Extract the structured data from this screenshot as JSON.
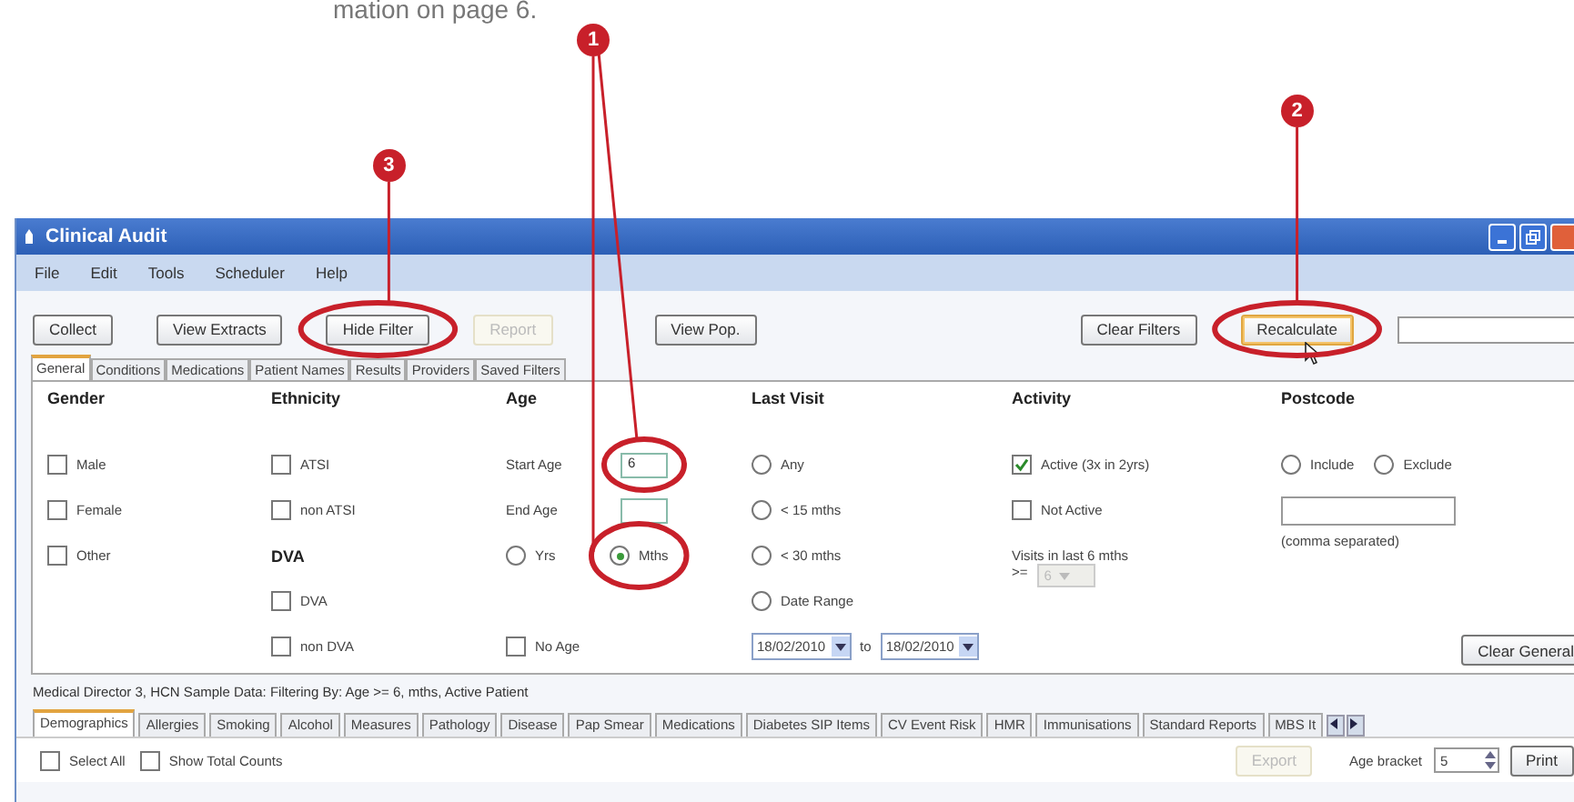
{
  "page_caption": "mation on page 6.",
  "callouts": [
    {
      "number": "1"
    },
    {
      "number": "2"
    },
    {
      "number": "3"
    }
  ],
  "window": {
    "title": "Clinical Audit",
    "menu": [
      "File",
      "Edit",
      "Tools",
      "Scheduler",
      "Help"
    ],
    "toolbar_left": [
      {
        "label": "Collect",
        "disabled": false
      },
      {
        "label": "View Extracts",
        "disabled": false
      },
      {
        "label": "Hide Filter",
        "disabled": false
      },
      {
        "label": "Report",
        "disabled": true
      },
      {
        "label": "View Pop.",
        "disabled": false
      }
    ],
    "toolbar_right": [
      {
        "label": "Clear Filters",
        "hovered": false
      },
      {
        "label": "Recalculate",
        "hovered": true
      }
    ],
    "filter_tabs": [
      {
        "label": "General",
        "selected": true
      },
      {
        "label": "Conditions",
        "selected": false
      },
      {
        "label": "Medications",
        "selected": false
      },
      {
        "label": "Patient Names",
        "selected": false
      },
      {
        "label": "Results",
        "selected": false
      },
      {
        "label": "Providers",
        "selected": false
      },
      {
        "label": "Saved Filters",
        "selected": false
      }
    ],
    "general": {
      "gender": {
        "heading": "Gender",
        "options": [
          {
            "label": "Male",
            "checked": false
          },
          {
            "label": "Female",
            "checked": false
          },
          {
            "label": "Other",
            "checked": false
          }
        ]
      },
      "ethnicity": {
        "heading": "Ethnicity",
        "options": [
          {
            "label": "ATSI",
            "checked": false
          },
          {
            "label": "non ATSI",
            "checked": false
          }
        ],
        "dva_heading": "DVA",
        "dva_options": [
          {
            "label": "DVA",
            "checked": false
          },
          {
            "label": "non DVA",
            "checked": false
          }
        ]
      },
      "age": {
        "heading": "Age",
        "start_label": "Start Age",
        "start_value": "6",
        "end_label": "End Age",
        "units": [
          {
            "label": "Yrs",
            "selected": false
          },
          {
            "label": "Mths",
            "selected": true
          }
        ],
        "no_age": {
          "label": "No Age",
          "checked": false
        }
      },
      "last_visit": {
        "heading": "Last Visit",
        "options": [
          {
            "label": "Any",
            "selected": false
          },
          {
            "label": "< 15 mths",
            "selected": false
          },
          {
            "label": "< 30 mths",
            "selected": false
          },
          {
            "label": "Date Range",
            "selected": false
          }
        ],
        "date_from": "18/02/2010",
        "to_label": "to",
        "date_to": "18/02/2010"
      },
      "activity": {
        "heading": "Activity",
        "options": [
          {
            "label": "Active (3x in 2yrs)",
            "checked": true
          },
          {
            "label": "Not Active",
            "checked": false
          }
        ],
        "visits_label": "Visits in last 6 mths",
        "ge_label": ">=",
        "visits_value": "6"
      },
      "postcode": {
        "heading": "Postcode",
        "options": [
          {
            "label": "Include",
            "selected": false
          },
          {
            "label": "Exclude",
            "selected": false
          }
        ],
        "hint": "(comma separated)"
      },
      "clear_button": "Clear General"
    },
    "status": "Medical Director 3, HCN Sample Data: Filtering By: Age >= 6, mths, Active Patient",
    "report_tabs": [
      {
        "label": "Demographics",
        "selected": true
      },
      {
        "label": "Allergies",
        "selected": false
      },
      {
        "label": "Smoking",
        "selected": false
      },
      {
        "label": "Alcohol",
        "selected": false
      },
      {
        "label": "Measures",
        "selected": false
      },
      {
        "label": "Pathology",
        "selected": false
      },
      {
        "label": "Disease",
        "selected": false
      },
      {
        "label": "Pap Smear",
        "selected": false
      },
      {
        "label": "Medications",
        "selected": false
      },
      {
        "label": "Diabetes SIP Items",
        "selected": false
      },
      {
        "label": "CV Event Risk",
        "selected": false
      },
      {
        "label": "HMR",
        "selected": false
      },
      {
        "label": "Immunisations",
        "selected": false
      },
      {
        "label": "Standard Reports",
        "selected": false
      },
      {
        "label": "MBS It",
        "selected": false
      }
    ],
    "bottom": {
      "checks": [
        {
          "label": "Select All",
          "checked": false
        },
        {
          "label": "Show Total Counts",
          "checked": false
        }
      ],
      "export": "Export",
      "age_bracket_label": "Age bracket",
      "age_bracket": "5",
      "print": "Print"
    }
  }
}
